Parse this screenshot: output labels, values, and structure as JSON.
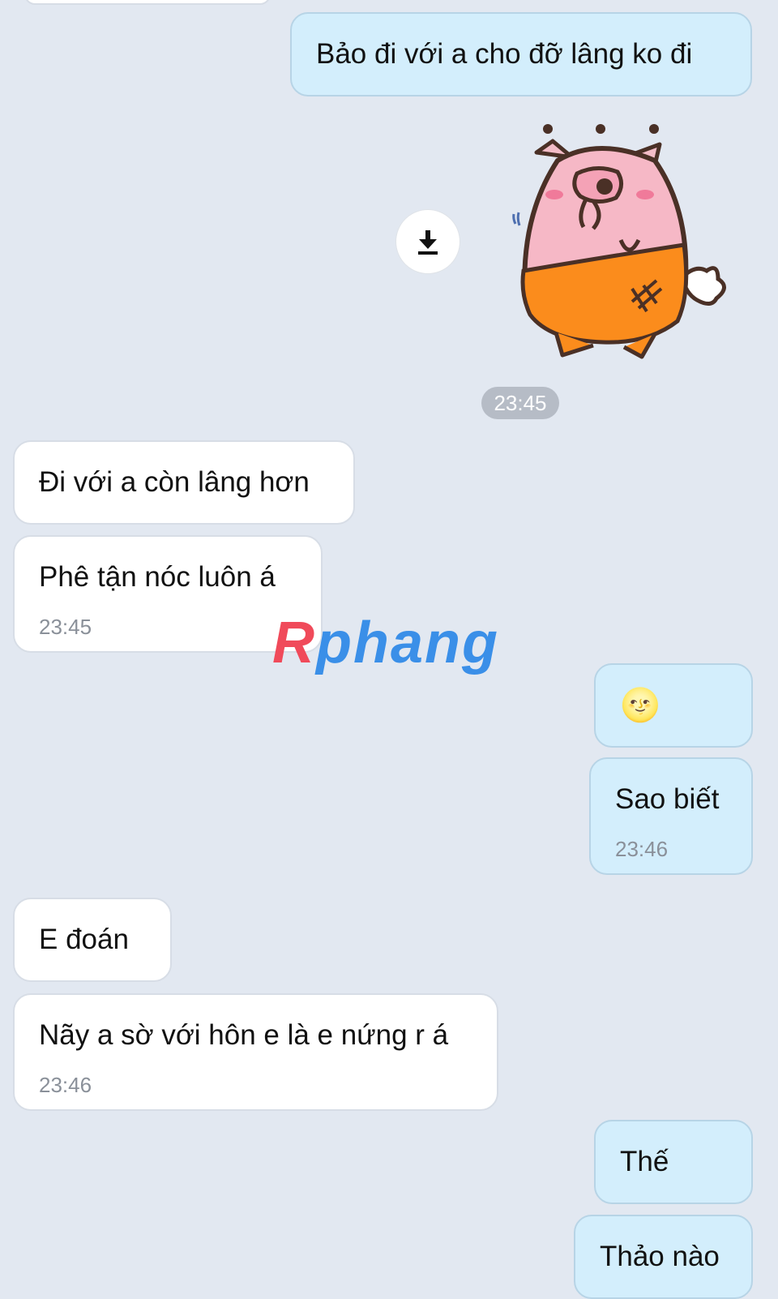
{
  "messages": [
    {
      "side": "out",
      "text": "Bảo đi với a cho đỡ lâng ko đi"
    },
    {
      "side": "in",
      "text": "Đi với a còn lâng hơn"
    },
    {
      "side": "in",
      "text": "Phê tận nóc luôn á",
      "time": "23:45"
    },
    {
      "side": "out",
      "emoji": "🌝"
    },
    {
      "side": "out",
      "text": "Sao biết",
      "time": "23:46"
    },
    {
      "side": "in",
      "text": "E đoán"
    },
    {
      "side": "in",
      "text": "Nãy a sờ với hôn e là e nứng r á",
      "time": "23:46"
    },
    {
      "side": "out",
      "text": "Thế"
    },
    {
      "side": "out",
      "text": "Thảo nào"
    }
  ],
  "sticker": {
    "icon": "pig-sticker-icon",
    "time": "23:45"
  },
  "download_icon": "download-icon",
  "watermark": {
    "r": "R",
    "rest": "phang"
  },
  "colors": {
    "background": "#e2e8f1",
    "outgoing_bubble": "#d3eefc",
    "incoming_bubble": "#ffffff"
  }
}
